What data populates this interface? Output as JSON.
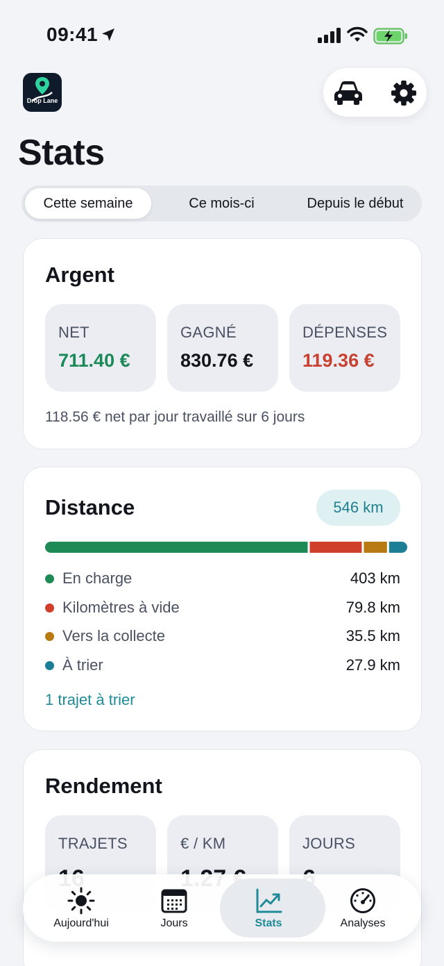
{
  "status_bar": {
    "time": "09:41"
  },
  "header": {
    "logo_text": "Drop Lane",
    "title": "Stats"
  },
  "periods": {
    "week": "Cette semaine",
    "month": "Ce mois-ci",
    "all": "Depuis le début",
    "selected": "week"
  },
  "money": {
    "title": "Argent",
    "net_label": "NET",
    "net_value": "711.40 €",
    "earned_label": "GAGNÉ",
    "earned_value": "830.76 €",
    "expenses_label": "DÉPENSES",
    "expenses_value": "119.36 €",
    "note": "118.56 € net par jour travaillé sur 6 jours"
  },
  "distance": {
    "title": "Distance",
    "total": "546 km",
    "breakdown": [
      {
        "label": "En charge",
        "value": "403 km",
        "km": 403,
        "color": "#1f8a55"
      },
      {
        "label": "Kilomètres à vide",
        "value": "79.8 km",
        "km": 79.8,
        "color": "#cf3f2c"
      },
      {
        "label": "Vers la collecte",
        "value": "35.5 km",
        "km": 35.5,
        "color": "#b87a12"
      },
      {
        "label": "À trier",
        "value": "27.9 km",
        "km": 27.9,
        "color": "#1d7f95"
      }
    ],
    "sort_link": "1 trajet à trier"
  },
  "yield": {
    "title": "Rendement",
    "trips_label": "TRAJETS",
    "trips_value": "16",
    "per_km_label": "€ / KM",
    "per_km_value": "1.27 €",
    "days_label": "JOURS",
    "days_value": "6"
  },
  "tabs": {
    "today": "Aujourd'hui",
    "days": "Jours",
    "stats": "Stats",
    "analyses": "Analyses",
    "active": "stats"
  },
  "colors": {
    "accent": "#1f8a98",
    "positive": "#1c8a58",
    "negative": "#c8402f"
  }
}
